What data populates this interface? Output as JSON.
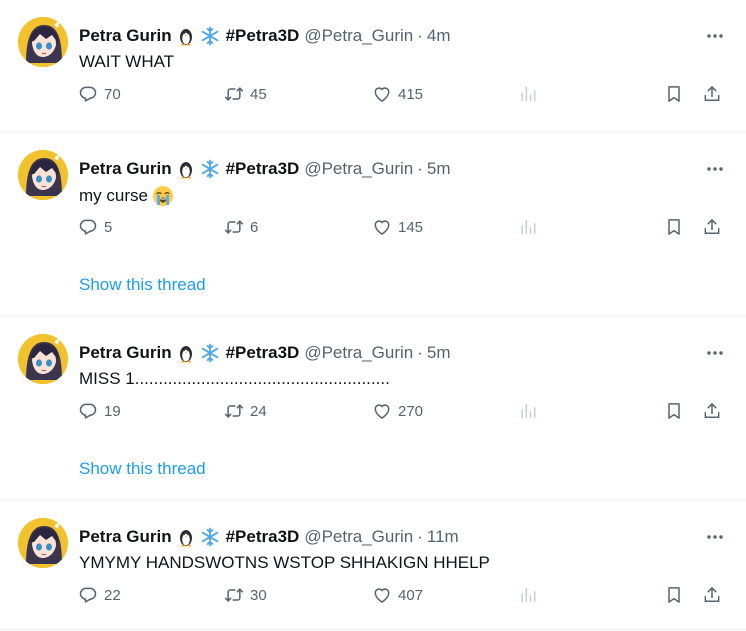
{
  "tweets": [
    {
      "name": "Petra Gurin",
      "hashtag": "#Petra3D",
      "handle": "@Petra_Gurin",
      "separator": "·",
      "time": "4m",
      "text": "WAIT WHAT",
      "text_emoji": "",
      "replies": "70",
      "retweets": "45",
      "likes": "415",
      "show_thread": ""
    },
    {
      "name": "Petra Gurin",
      "hashtag": "#Petra3D",
      "handle": "@Petra_Gurin",
      "separator": "·",
      "time": "5m",
      "text": "my curse",
      "text_emoji": "loudly-crying-face",
      "replies": "5",
      "retweets": "6",
      "likes": "145",
      "show_thread": "Show this thread"
    },
    {
      "name": "Petra Gurin",
      "hashtag": "#Petra3D",
      "handle": "@Petra_Gurin",
      "separator": "·",
      "time": "5m",
      "text": "MISS 1......................................................",
      "text_emoji": "",
      "replies": "19",
      "retweets": "24",
      "likes": "270",
      "show_thread": "Show this thread"
    },
    {
      "name": "Petra Gurin",
      "hashtag": "#Petra3D",
      "handle": "@Petra_Gurin",
      "separator": "·",
      "time": "11m",
      "text": "YMYMY HANDSWOTNS WSTOP SHHAKIGN HHELP",
      "text_emoji": "",
      "replies": "22",
      "retweets": "30",
      "likes": "407",
      "show_thread": ""
    }
  ],
  "icons": {
    "name_emojis": [
      "penguin-icon",
      "snowflake-icon"
    ],
    "actions": [
      "reply-icon",
      "retweet-icon",
      "like-icon",
      "views-icon",
      "bookmark-icon",
      "share-icon"
    ],
    "more": "more-icon"
  },
  "colors": {
    "text": "#0f1419",
    "secondary": "#536471",
    "link": "#1d9bf0",
    "divider": "#eff3f4",
    "snowflake": "#4da6e8"
  }
}
